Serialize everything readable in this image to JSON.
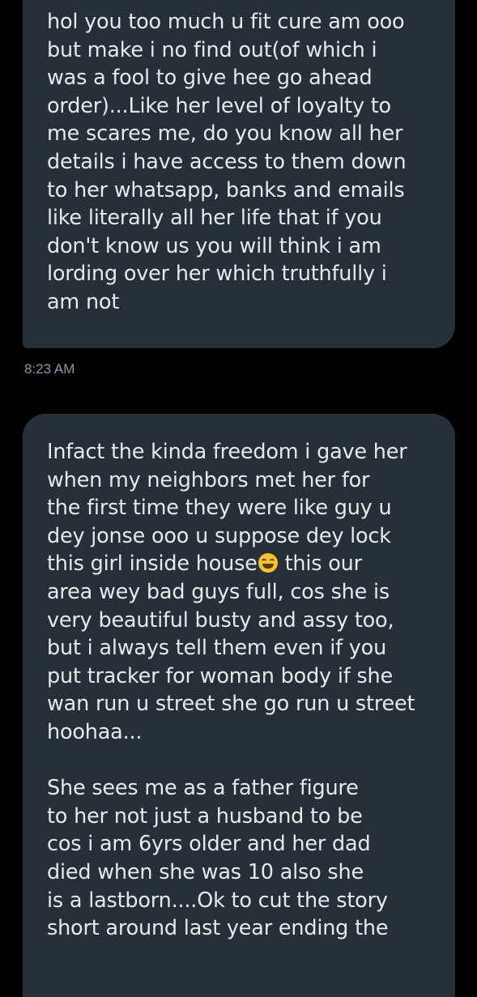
{
  "messages": [
    {
      "lines": [
        "hol you too much u fit cure am ooo",
        "but make i no find out(of which i",
        "was a fool to give hee go ahead",
        "order)...Like her level of loyalty to",
        "me scares me, do you know all her",
        "details i have access to them down",
        "to her whatsapp, banks and emails",
        "like literally all her life that if you",
        "don't know us you will think i am",
        "lording over her which truthfully i",
        "am not"
      ],
      "timestamp": "8:23 AM"
    },
    {
      "paragraph1": [
        "Infact the kinda freedom i gave her",
        "when my neighbors met her for",
        "the first time they were like guy u",
        "dey jonse ooo u suppose dey lock"
      ],
      "emoji_line": {
        "before": "this girl inside house",
        "emoji": "grinning-squinting-face-emoji",
        "after": " this our"
      },
      "paragraph1_rest": [
        "area wey bad guys full, cos she is",
        "very beautiful busty and assy too,",
        "but i always tell them even if you",
        "put tracker for woman body if she",
        "wan run u street she go run u street",
        "hoohaa..."
      ],
      "paragraph2": [
        "She sees me as a father figure",
        "to her not just a husband to be",
        "cos i am 6yrs older and her dad",
        "died when she was 10 also she",
        "is a lastborn....Ok to cut the story",
        "short around last year ending the"
      ]
    }
  ],
  "colors": {
    "background": "#000000",
    "bubble": "#273038",
    "text": "#e7e9ea",
    "timestamp": "#8b98a5"
  }
}
